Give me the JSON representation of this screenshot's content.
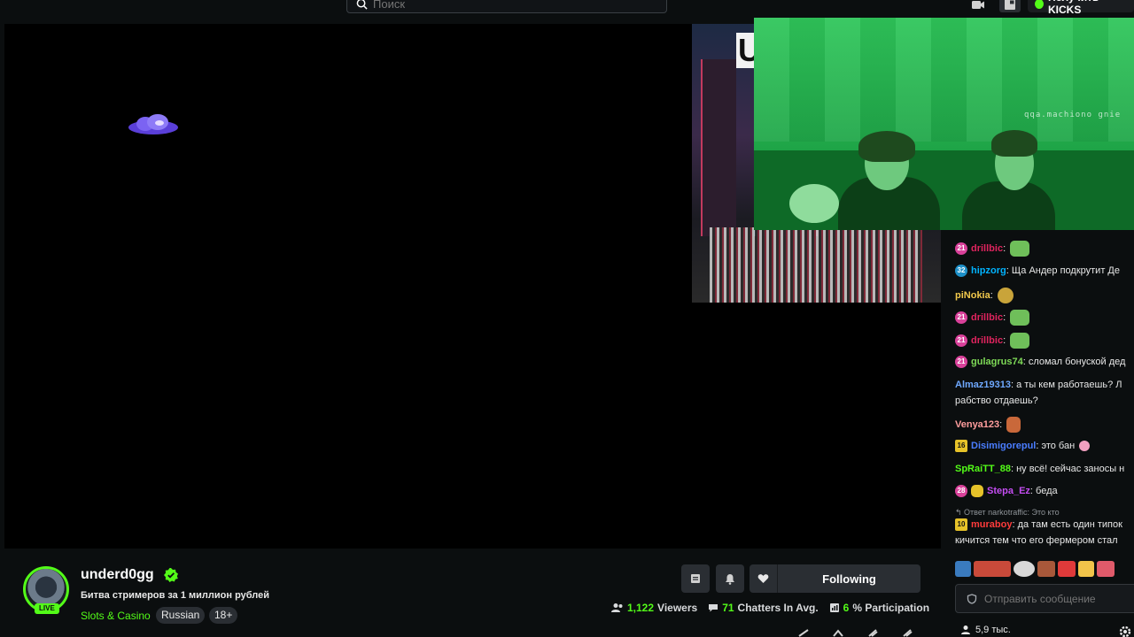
{
  "header": {
    "search_placeholder": "Поиск",
    "kicks_label": "Получить KICKS"
  },
  "player": {
    "screen_overlay_letter": "U",
    "camera_watermark": "qqa.machiono gnie"
  },
  "chat": {
    "messages": [
      {
        "badge": "21",
        "badge_color": "#d9419a",
        "user": "drillbic",
        "user_color": "#e0245e",
        "text": "",
        "emote": true
      },
      {
        "badge": "32",
        "badge_color": "#1e90c8",
        "user": "hipzorg",
        "user_color": "#00b3ff",
        "text": "Ща Андер подкрутит Де",
        "emote": false
      },
      {
        "badge": "",
        "badge_color": "",
        "user": "piNokia",
        "user_color": "#f2c94c",
        "text": "",
        "emote": true
      },
      {
        "badge": "21",
        "badge_color": "#d9419a",
        "user": "drillbic",
        "user_color": "#e0245e",
        "text": "",
        "emote": true
      },
      {
        "badge": "21",
        "badge_color": "#d9419a",
        "user": "drillbic",
        "user_color": "#e0245e",
        "text": "",
        "emote": true
      },
      {
        "badge": "21",
        "badge_color": "#d9419a",
        "user": "gulagrus74",
        "user_color": "#7ed957",
        "text": "сломал бонуской дед",
        "emote": false
      },
      {
        "badge": "",
        "badge_color": "",
        "user": "Almaz19313",
        "user_color": "#6ea8fe",
        "text": "а ты кем работаешь? Л",
        "emote": false,
        "text2": "рабство отдаешь?"
      },
      {
        "badge": "",
        "badge_color": "",
        "user": "Venya123",
        "user_color": "#ff9d9d",
        "text": "",
        "emote": true
      },
      {
        "badge": "16",
        "badge_color": "#e6c229",
        "user": "Disimigorepul",
        "user_color": "#4a7dff",
        "text": "это бан",
        "emote": false
      },
      {
        "badge": "",
        "badge_color": "",
        "user": "SpRaiTT_88",
        "user_color": "#53fc18",
        "text": "ну всё! сейчас заносы н",
        "emote": false
      },
      {
        "badge": "28",
        "badge_color": "#d9419a",
        "user": "Stepa_Ez",
        "user_color": "#c44df2",
        "text": "беда",
        "emote": false
      },
      {
        "badge": "10",
        "badge_color": "#e6c229",
        "user": "muraboy",
        "user_color": "#ff3b3b",
        "text": "да там есть один типок",
        "emote": false,
        "text2": "кичится тем что его фермером стал"
      }
    ],
    "reply_text": "Ответ narkotraffic: Это кто",
    "input_placeholder": "Отправить сообщение",
    "viewers_footer": "5,9 тыс."
  },
  "streamer": {
    "name": "underd0gg",
    "live_label": "LIVE",
    "title": "Битва стримеров за 1 миллион рублей",
    "category": "Slots & Casino",
    "tags": [
      "Russian",
      "18+"
    ]
  },
  "actions": {
    "follow_label": "Following"
  },
  "stats": {
    "viewers_num": "1,122",
    "viewers_label": "Viewers",
    "chatters_num": "71",
    "chatters_label": "Chatters In Avg.",
    "participation_num": "6",
    "participation_label": "% Participation"
  },
  "colors": {
    "accent": "#53fc18",
    "background": "#0b0e0f",
    "button_bg": "#2a2e33"
  }
}
